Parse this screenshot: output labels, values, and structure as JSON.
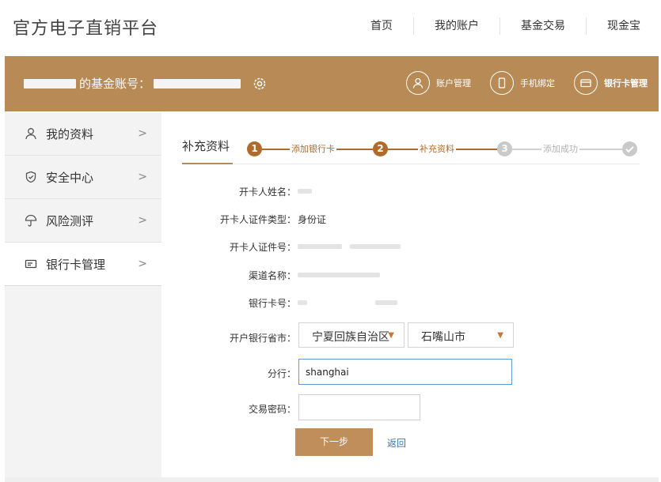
{
  "brand": "官方电子直销平台",
  "top_nav": [
    "首页",
    "我的账户",
    "基金交易",
    "现金宝"
  ],
  "header": {
    "account_label": "的基金账号：",
    "nav": [
      "账户管理",
      "手机绑定",
      "银行卡管理"
    ]
  },
  "sidebar": {
    "items": [
      {
        "label": "我的资料",
        "icon": "user-icon"
      },
      {
        "label": "安全中心",
        "icon": "shield-icon"
      },
      {
        "label": "风险测评",
        "icon": "umbrella-icon"
      },
      {
        "label": "银行卡管理",
        "icon": "bank-card-icon"
      }
    ],
    "active_index": 3,
    "chevron": ">"
  },
  "main": {
    "tab_label": "补充资料",
    "steps": [
      {
        "num": "1",
        "label": "添加银行卡",
        "state": "done"
      },
      {
        "num": "2",
        "label": "补充资料",
        "state": "current"
      },
      {
        "num": "3",
        "label": "添加成功",
        "state": "pending"
      }
    ],
    "form": {
      "holder_name_label": "开卡人姓名：",
      "id_type_label": "开卡人证件类型：",
      "id_type_value": "身份证",
      "id_number_label": "开卡人证件号：",
      "channel_label": "渠道名称：",
      "card_number_label": "银行卡号：",
      "province_city_label": "开户银行省市：",
      "province_value": "宁夏回族自治区",
      "city_value": "石嘴山市",
      "branch_label": "分行：",
      "branch_value": "shanghai",
      "password_label": "交易密码：",
      "password_value": ""
    },
    "next_button": "下一步",
    "back_link": "返回"
  }
}
